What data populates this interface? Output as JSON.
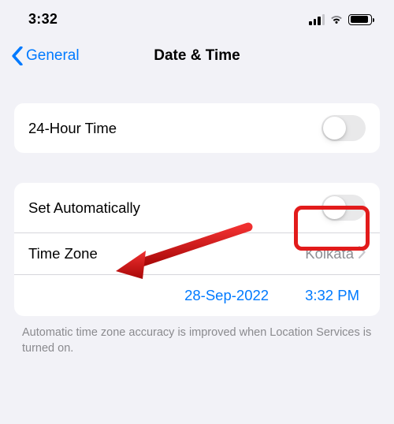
{
  "status": {
    "time": "3:32"
  },
  "nav": {
    "back_label": "General",
    "title": "Date & Time"
  },
  "group1": {
    "r24h_label": "24-Hour Time"
  },
  "group2": {
    "auto_label": "Set Automatically",
    "tz_label": "Time Zone",
    "tz_value": "Kolkata",
    "date_value": "28-Sep-2022",
    "time_value": "3:32 PM"
  },
  "footer": {
    "note": "Automatic time zone accuracy is improved when Location Services is turned on."
  }
}
